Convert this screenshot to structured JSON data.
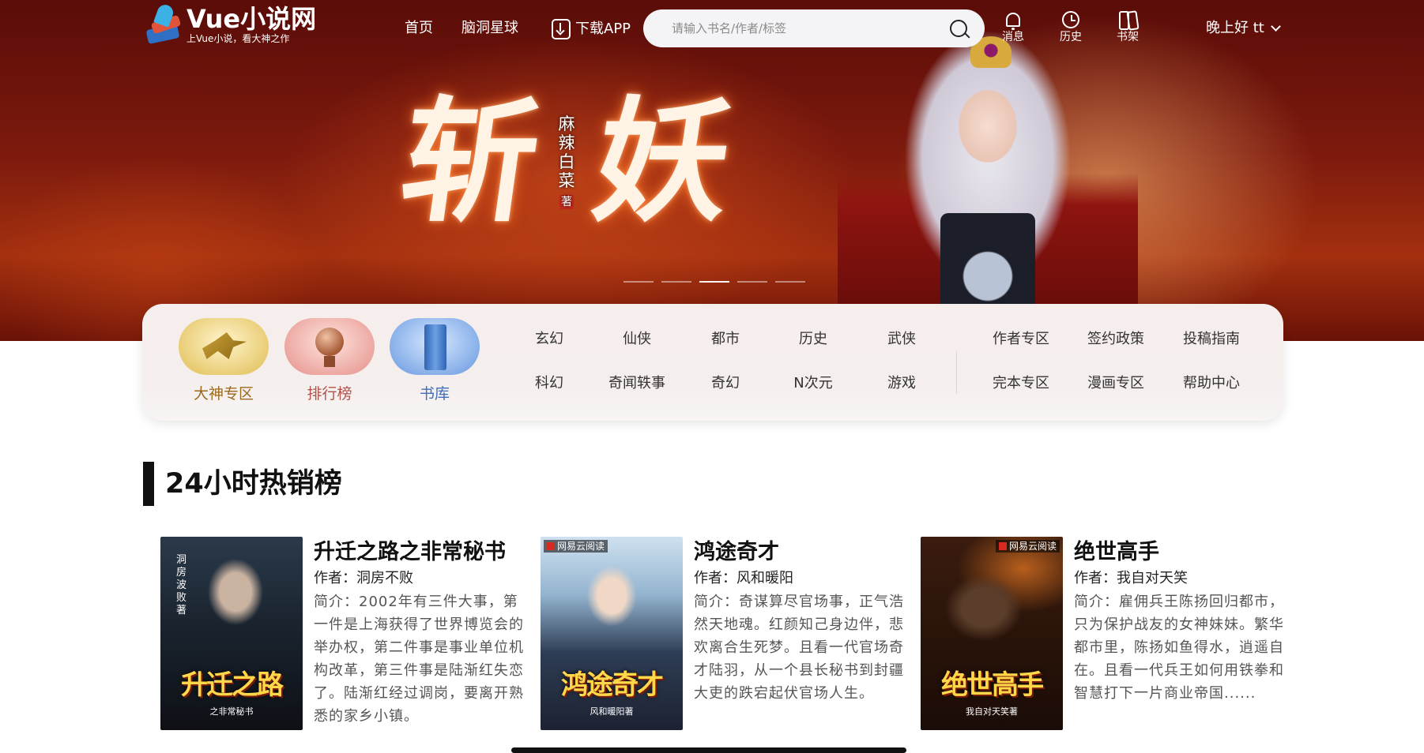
{
  "app": {
    "logo_name": "Vue小说网",
    "logo_slogan": "上Vue小说，看大神之作"
  },
  "nav": {
    "links": [
      "首页",
      "脑洞星球"
    ],
    "app_download": "下载APP",
    "search_placeholder": "请输入书名/作者/标签",
    "tools": [
      {
        "label": "消息",
        "icon": "bell-icon"
      },
      {
        "label": "历史",
        "icon": "clock-icon"
      },
      {
        "label": "书架",
        "icon": "bookshelf-icon"
      }
    ],
    "greeting": "晚上好 tt"
  },
  "banner": {
    "title_chars": [
      "斩",
      "妖"
    ],
    "author_vertical": "麻辣白菜",
    "author_seal": "著",
    "slide_count": 5,
    "active_slide": 3
  },
  "categories": {
    "zones": [
      {
        "label": "大神专区",
        "icon": "pegasus-icon"
      },
      {
        "label": "排行榜",
        "icon": "medal-icon"
      },
      {
        "label": "书库",
        "icon": "book-icon"
      }
    ],
    "genres": [
      "玄幻",
      "仙侠",
      "都市",
      "历史",
      "武侠",
      "科幻",
      "奇闻轶事",
      "奇幻",
      "N次元",
      "游戏"
    ],
    "services": [
      "作者专区",
      "签约政策",
      "投稿指南",
      "完本专区",
      "漫画专区",
      "帮助中心"
    ]
  },
  "hot_sales": {
    "title": "24小时热销榜",
    "books": [
      {
        "title": "升迁之路之非常秘书",
        "author": "作者：洞房不败",
        "desc": "简介：2002年有三件大事，第一件是上海获得了世界博览会的举办权，第二件事是事业单位机构改革，第三件事是陆渐红失恋了。陆渐红经过调岗，要离开熟悉的家乡小镇。",
        "cover_title": "升迁之路",
        "cover_sub": "之非常秘书",
        "cover_author": "洞房波败著"
      },
      {
        "title": "鸿途奇才",
        "author": "作者：风和暖阳",
        "desc": "简介：奇谋算尽官场事，正气浩然天地魂。红颜知己身边伴，悲欢离合生死梦。且看一代官场奇才陆羽，从一个县长秘书到封疆大吏的跌宕起伏官场人生。",
        "cover_title": "鸿途奇才",
        "cover_sub": "风和暖阳著",
        "cover_badge": "网易云阅读"
      },
      {
        "title": "绝世高手",
        "author": "作者：我自对天笑",
        "desc": "简介：雇佣兵王陈扬回归都市，只为保护战友的女神妹妹。繁华都市里，陈扬如鱼得水，逍遥自在。且看一代兵王如何用铁拳和智慧打下一片商业帝国......",
        "cover_title": "绝世高手",
        "cover_sub": "我自对天笑著",
        "cover_badge": "网易云阅读"
      }
    ]
  }
}
